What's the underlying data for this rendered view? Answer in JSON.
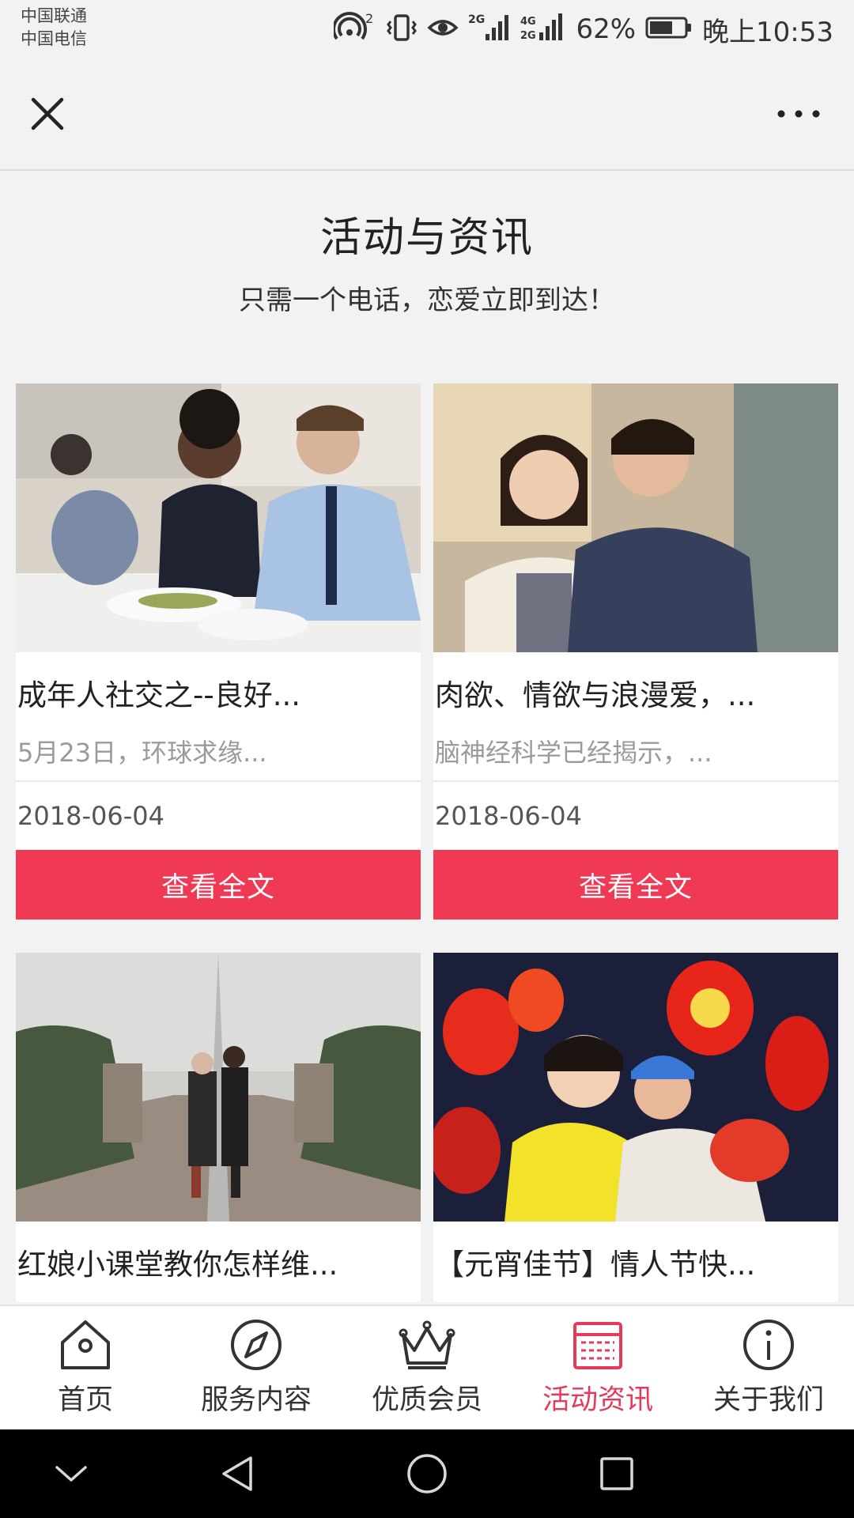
{
  "status_bar": {
    "carrier_1": "中国联通",
    "carrier_2": "中国电信",
    "hotspot_count": "2",
    "signal_1_label": "2G",
    "signal_2_label_top": "4G",
    "signal_2_label_bottom": "2G",
    "battery": "62%",
    "time": "晚上10:53"
  },
  "page": {
    "title": "活动与资讯",
    "subtitle": "只需一个电话，恋爱立即到达！"
  },
  "articles": [
    {
      "title": "成年人社交之--良好...",
      "summary": "5月23日，环球求缘...",
      "date": "2018-06-04",
      "button": "查看全文"
    },
    {
      "title": "肉欲、情欲与浪漫爱，...",
      "summary": "脑神经科学已经揭示，...",
      "date": "2018-06-04",
      "button": "查看全文"
    },
    {
      "title": "红娘小课堂教你怎样维..."
    },
    {
      "title": "【元宵佳节】情人节快..."
    }
  ],
  "nav": {
    "items": [
      {
        "label": "首页",
        "icon": "home-icon"
      },
      {
        "label": "服务内容",
        "icon": "compass-icon"
      },
      {
        "label": "优质会员",
        "icon": "crown-icon"
      },
      {
        "label": "活动资讯",
        "icon": "news-icon"
      },
      {
        "label": "关于我们",
        "icon": "info-icon"
      }
    ],
    "active_index": 3
  },
  "colors": {
    "accent": "#f03a55",
    "nav_active": "#e63a5a",
    "background": "#f2f2f2"
  }
}
